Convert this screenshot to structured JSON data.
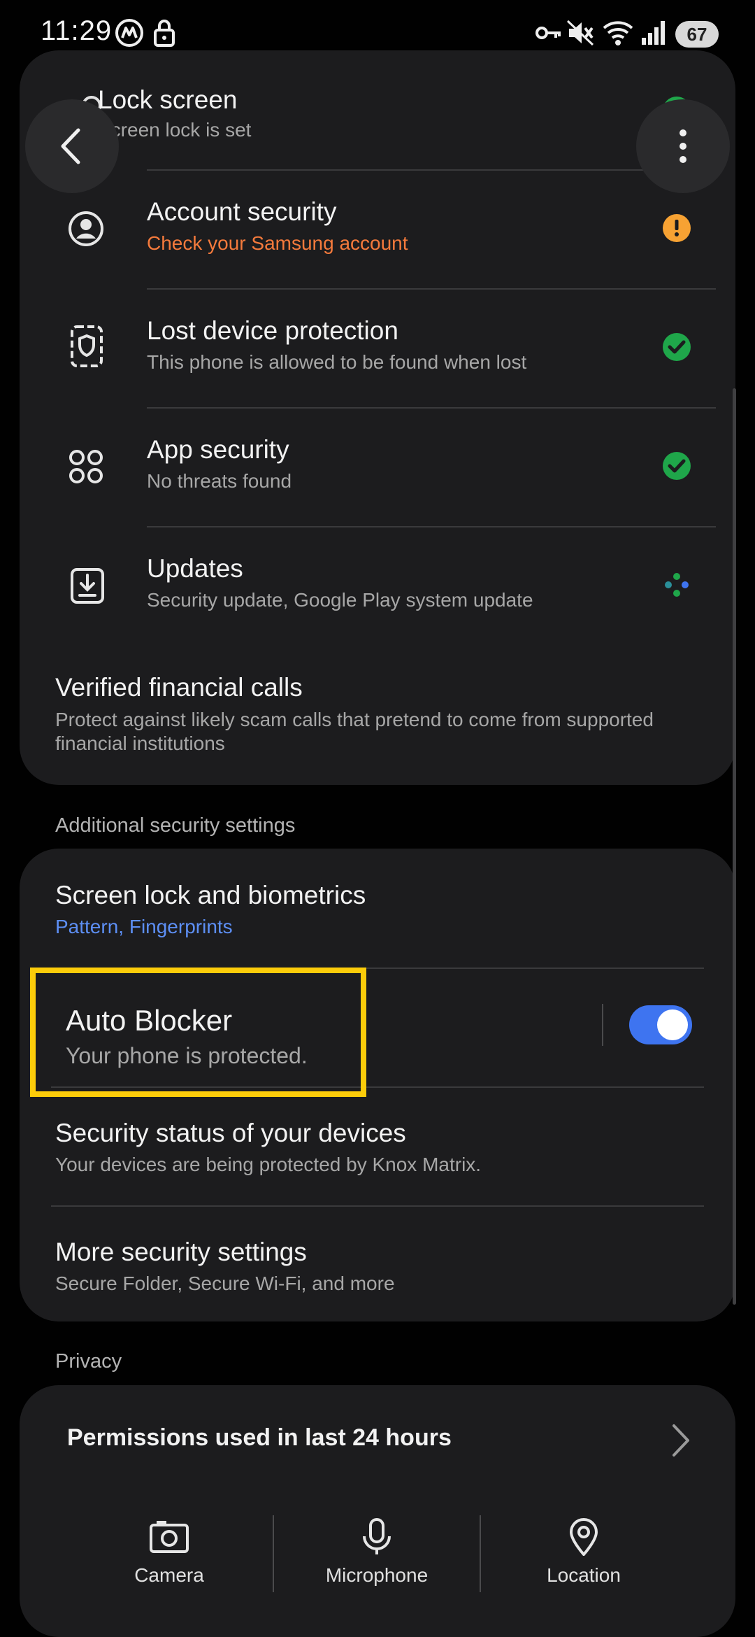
{
  "status_bar": {
    "time": "11:29",
    "battery": "67",
    "icons": [
      "m-logo-icon",
      "lock-icon",
      "vpn-key-icon",
      "mute-icon",
      "wifi-icon",
      "signal-icon",
      "battery-icon"
    ]
  },
  "nav": {
    "back_icon": "chevron-left-icon",
    "more_icon": "more-vertical-icon"
  },
  "security_card": {
    "items": [
      {
        "title": "Lock screen",
        "subtitle": "Screen lock is set",
        "icon": "lock-search-icon",
        "status": "check"
      },
      {
        "title": "Account security",
        "subtitle": "Check your Samsung account",
        "icon": "account-icon",
        "status": "warning"
      },
      {
        "title": "Lost device protection",
        "subtitle": "This phone is allowed to be found when lost",
        "icon": "device-shield-icon",
        "status": "check"
      },
      {
        "title": "App security",
        "subtitle": "No threats found",
        "icon": "apps-grid-icon",
        "status": "check"
      },
      {
        "title": "Updates",
        "subtitle": "Security update, Google Play system update",
        "icon": "download-box-icon",
        "status": "loading"
      }
    ],
    "verified_calls": {
      "title": "Verified financial calls",
      "subtitle": "Protect against likely scam calls that pretend to come from supported financial institutions"
    }
  },
  "additional": {
    "header": "Additional security settings",
    "screen_lock": {
      "title": "Screen lock and biometrics",
      "subtitle": "Pattern, Fingerprints"
    },
    "auto_blocker": {
      "title": "Auto Blocker",
      "subtitle": "Your phone is protected.",
      "enabled": true
    },
    "device_status": {
      "title": "Security status of your devices",
      "subtitle": "Your devices are being protected by Knox Matrix."
    },
    "more": {
      "title": "More security settings",
      "subtitle": "Secure Folder, Secure Wi-Fi, and more"
    }
  },
  "privacy": {
    "header": "Privacy",
    "permissions_title": "Permissions used in last 24 hours",
    "items": [
      {
        "label": "Camera",
        "icon": "camera-icon"
      },
      {
        "label": "Microphone",
        "icon": "microphone-icon"
      },
      {
        "label": "Location",
        "icon": "location-pin-icon"
      }
    ]
  },
  "colors": {
    "accent_blue": "#3e74f0",
    "link_blue": "#5d8ff5",
    "warning_orange": "#f7a233",
    "account_subtitle": "#f47a3c",
    "check_green": "#1fa64a",
    "highlight_yellow": "#fccc0a"
  }
}
